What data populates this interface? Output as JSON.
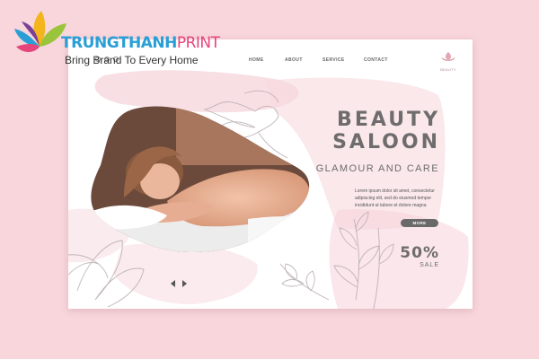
{
  "watermark": {
    "brand_part1": "TRUNGTHANH",
    "brand_part2": "PRINT",
    "tagline": "Bring Brand To Every Home"
  },
  "nav": {
    "links": [
      "HOME",
      "ABOUT",
      "SERVICE",
      "CONTACT"
    ],
    "social_icons": [
      "instagram-icon",
      "facebook-icon",
      "twitter-icon"
    ]
  },
  "hero": {
    "title_line1": "BEAUTY",
    "title_line2": "SALOON",
    "subtitle": "GLAMOUR AND CARE",
    "body": "Lorem ipsum dolor sit amet, consectetur adipiscing elit, sed do eiusmod tempor incididunt ut labore et dolore magna",
    "more_label": "MORE"
  },
  "sale": {
    "percent": "50%",
    "label": "SALE"
  },
  "colors": {
    "page_background": "#f8d6dc",
    "accent_pink": "#f3c7d0",
    "text_gray": "#6e6c6c",
    "button_gray": "#6a6a6a"
  }
}
